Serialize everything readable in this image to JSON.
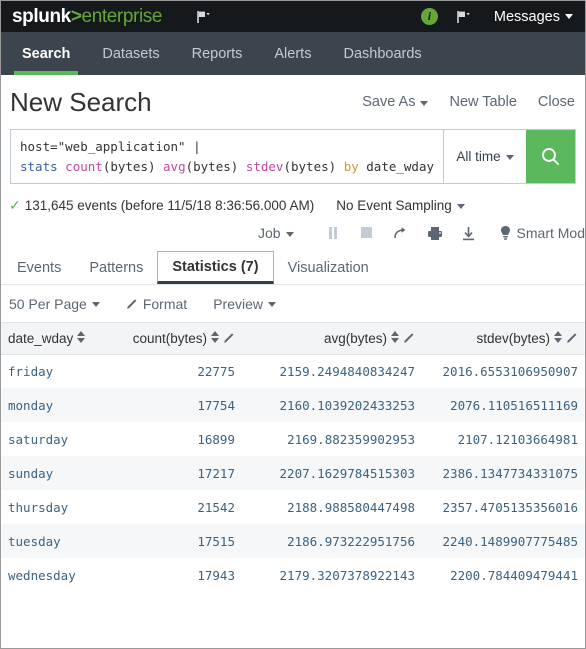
{
  "topbar": {
    "logo_word": "splunk",
    "logo_gt": ">",
    "logo_enterprise": "enterprise",
    "flag_icon": "flag-icon",
    "info_icon": "info-circle-icon",
    "info_glyph": "i",
    "flag_icon_2": "flag-icon",
    "messages_label": "Messages",
    "accent_green": "#65a637",
    "bar_color": "#16191c"
  },
  "appnav": {
    "items": [
      {
        "label": "Search",
        "active": true
      },
      {
        "label": "Datasets",
        "active": false
      },
      {
        "label": "Reports",
        "active": false
      },
      {
        "label": "Alerts",
        "active": false
      },
      {
        "label": "Dashboards",
        "active": false
      }
    ],
    "bar_color": "#3c444d",
    "active_underline": "#5cb85c"
  },
  "title": {
    "text": "New Search",
    "actions": [
      {
        "label": "Save As",
        "caret": true
      },
      {
        "label": "New Table",
        "caret": false
      },
      {
        "label": "Close",
        "caret": false
      }
    ]
  },
  "search": {
    "line1": "host=\"web_application\" |",
    "line2_tokens": [
      {
        "text": "stats",
        "type": "command"
      },
      {
        "text": " ",
        "type": "plain"
      },
      {
        "text": "count",
        "type": "function"
      },
      {
        "text": "(bytes) ",
        "type": "plain"
      },
      {
        "text": "avg",
        "type": "function"
      },
      {
        "text": "(bytes) ",
        "type": "plain"
      },
      {
        "text": "stdev",
        "type": "function"
      },
      {
        "text": "(bytes) ",
        "type": "plain"
      },
      {
        "text": "by",
        "type": "keyword"
      },
      {
        "text": " date_wday",
        "type": "plain"
      }
    ],
    "time_range": "All time",
    "search_icon": "magnifier-icon",
    "search_button_color": "#5cb85c"
  },
  "events": {
    "check_icon": "checkmark-icon",
    "summary": "131,645 events (before 11/5/18 8:36:56.000 AM)",
    "sampling_label": "No Event Sampling"
  },
  "job": {
    "job_label": "Job",
    "icons": [
      {
        "name": "pause-icon",
        "glyph": "❙❙",
        "dim": true
      },
      {
        "name": "stop-icon",
        "glyph": "■",
        "dim": true
      },
      {
        "name": "share-icon",
        "glyph": "↱",
        "dim": false
      },
      {
        "name": "print-icon",
        "glyph": "🖶",
        "dim": false
      },
      {
        "name": "export-download-icon",
        "glyph": "⤓",
        "dim": false
      }
    ],
    "mode_icon": "lightbulb-icon",
    "mode_label": "Smart Mod"
  },
  "result_tabs": [
    {
      "label": "Events",
      "active": false
    },
    {
      "label": "Patterns",
      "active": false
    },
    {
      "label": "Statistics (7)",
      "active": true
    },
    {
      "label": "Visualization",
      "active": false
    }
  ],
  "format_toolbar": {
    "per_page": "50 Per Page",
    "format_label": "Format",
    "format_icon": "pencil-icon",
    "preview_label": "Preview"
  },
  "table": {
    "columns": [
      {
        "label": "date_wday",
        "sortable": true,
        "editable": false,
        "align": "left"
      },
      {
        "label": "count(bytes)",
        "sortable": true,
        "editable": true,
        "align": "right"
      },
      {
        "label": "avg(bytes)",
        "sortable": true,
        "editable": true,
        "align": "right"
      },
      {
        "label": "stdev(bytes)",
        "sortable": true,
        "editable": true,
        "align": "right"
      }
    ],
    "rows": [
      [
        "friday",
        "22775",
        "2159.2494840834247",
        "2016.6553106950907"
      ],
      [
        "monday",
        "17754",
        "2160.1039202433253",
        "2076.110516511169"
      ],
      [
        "saturday",
        "16899",
        "2169.882359902953",
        "2107.12103664981"
      ],
      [
        "sunday",
        "17217",
        "2207.1629784515303",
        "2386.1347734331075"
      ],
      [
        "thursday",
        "21542",
        "2188.988580447498",
        "2357.4705135356016"
      ],
      [
        "tuesday",
        "17515",
        "2186.973222951756",
        "2240.1489907775485"
      ],
      [
        "wednesday",
        "17943",
        "2179.3207378922143",
        "2200.784409479441"
      ]
    ]
  }
}
